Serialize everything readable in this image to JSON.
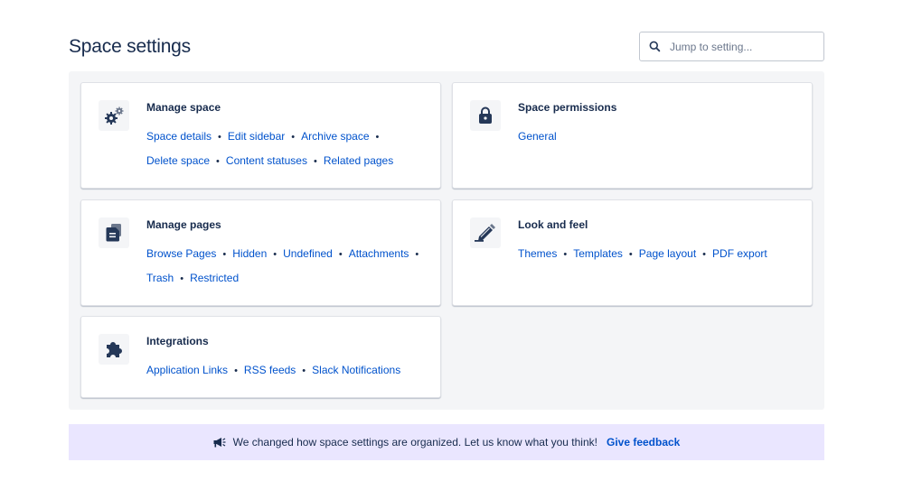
{
  "header": {
    "title": "Space settings",
    "search_placeholder": "Jump to setting...",
    "search_icon": "search-icon"
  },
  "cards": {
    "manage_space": {
      "icon": "gears-icon",
      "title": "Manage space",
      "links": [
        "Space details",
        "Edit sidebar",
        "Archive space",
        "Delete space",
        "Content statuses",
        "Related pages"
      ]
    },
    "space_permissions": {
      "icon": "lock-icon",
      "title": "Space permissions",
      "links": [
        "General"
      ]
    },
    "manage_pages": {
      "icon": "pages-icon",
      "title": "Manage pages",
      "links": [
        "Browse Pages",
        "Hidden",
        "Undefined",
        "Attachments",
        "Trash",
        "Restricted"
      ]
    },
    "look_and_feel": {
      "icon": "paintbrush-icon",
      "title": "Look and feel",
      "links": [
        "Themes",
        "Templates",
        "Page layout",
        "PDF export"
      ]
    },
    "integrations": {
      "icon": "puzzle-icon",
      "title": "Integrations",
      "links": [
        "Application Links",
        "RSS feeds",
        "Slack Notifications"
      ]
    }
  },
  "banner": {
    "icon": "megaphone-icon",
    "message": "We changed how space settings are organized. Let us know what you think!",
    "link": "Give feedback"
  },
  "colors": {
    "link": "#0052cc",
    "text": "#172b4d",
    "panel_bg": "#f4f5f7",
    "banner_bg": "#eae6ff"
  }
}
